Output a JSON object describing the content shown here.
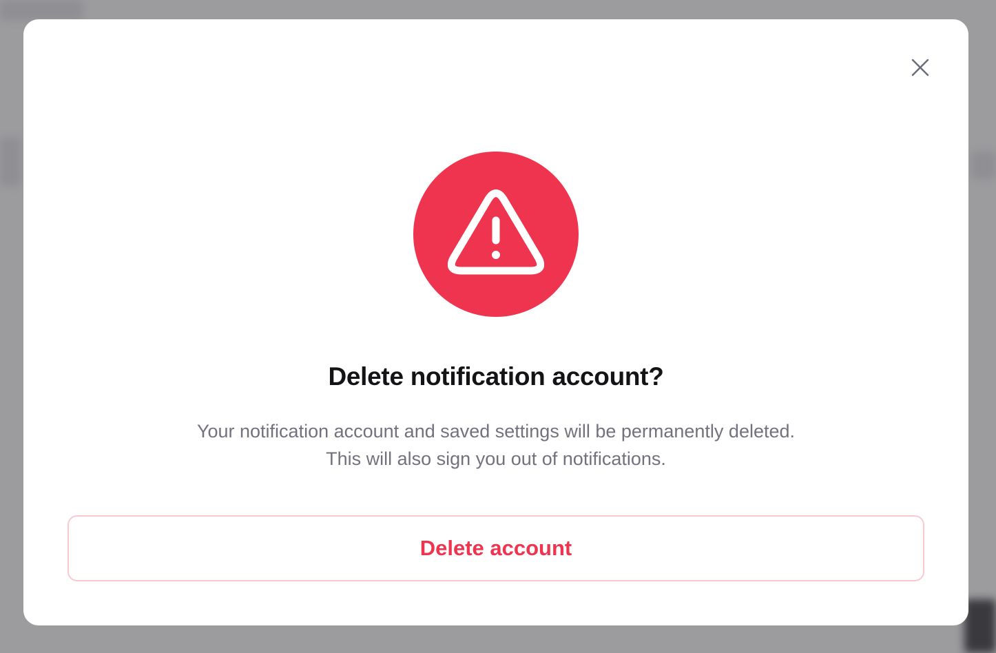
{
  "dialog": {
    "title": "Delete notification account?",
    "description_line1": "Your notification account and saved settings will be permanently deleted.",
    "description_line2": "This will also sign you out of notifications.",
    "delete_button_label": "Delete account",
    "close_icon": "close-icon",
    "warning_icon": "warning-triangle-icon"
  },
  "colors": {
    "danger": "#ee344e",
    "danger_border": "#f8c9d0",
    "title_text": "#141416",
    "body_text": "#72727e",
    "close_icon": "#6b6f7b"
  }
}
